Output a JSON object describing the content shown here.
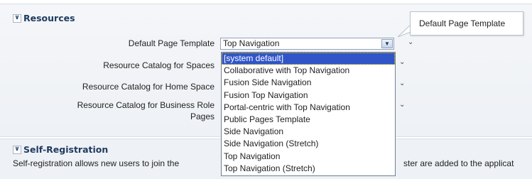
{
  "resources": {
    "header": "Resources",
    "labels": {
      "default_page_template": "Default Page Template",
      "catalog_spaces": "Resource Catalog for Spaces",
      "catalog_home": "Resource Catalog for Home Space",
      "catalog_business_line1": "Resource Catalog for Business Role",
      "catalog_business_line2": "Pages"
    },
    "select_value": "Top Navigation",
    "dropdown_options": [
      "[system default]",
      "Collaborative with Top Navigation",
      "Fusion Side Navigation",
      "Fusion Top Navigation",
      "Portal-centric with Top Navigation",
      "Public Pages Template",
      "Side Navigation",
      "Side Navigation (Stretch)",
      "Top Navigation",
      "Top Navigation (Stretch)"
    ],
    "highlighted_option": "[system default]",
    "tooltip": "Default Page Template"
  },
  "self_registration": {
    "header": "Self-Registration",
    "desc_left": "Self-registration allows new users to join the",
    "desc_right": "ster are added to the applicat"
  }
}
